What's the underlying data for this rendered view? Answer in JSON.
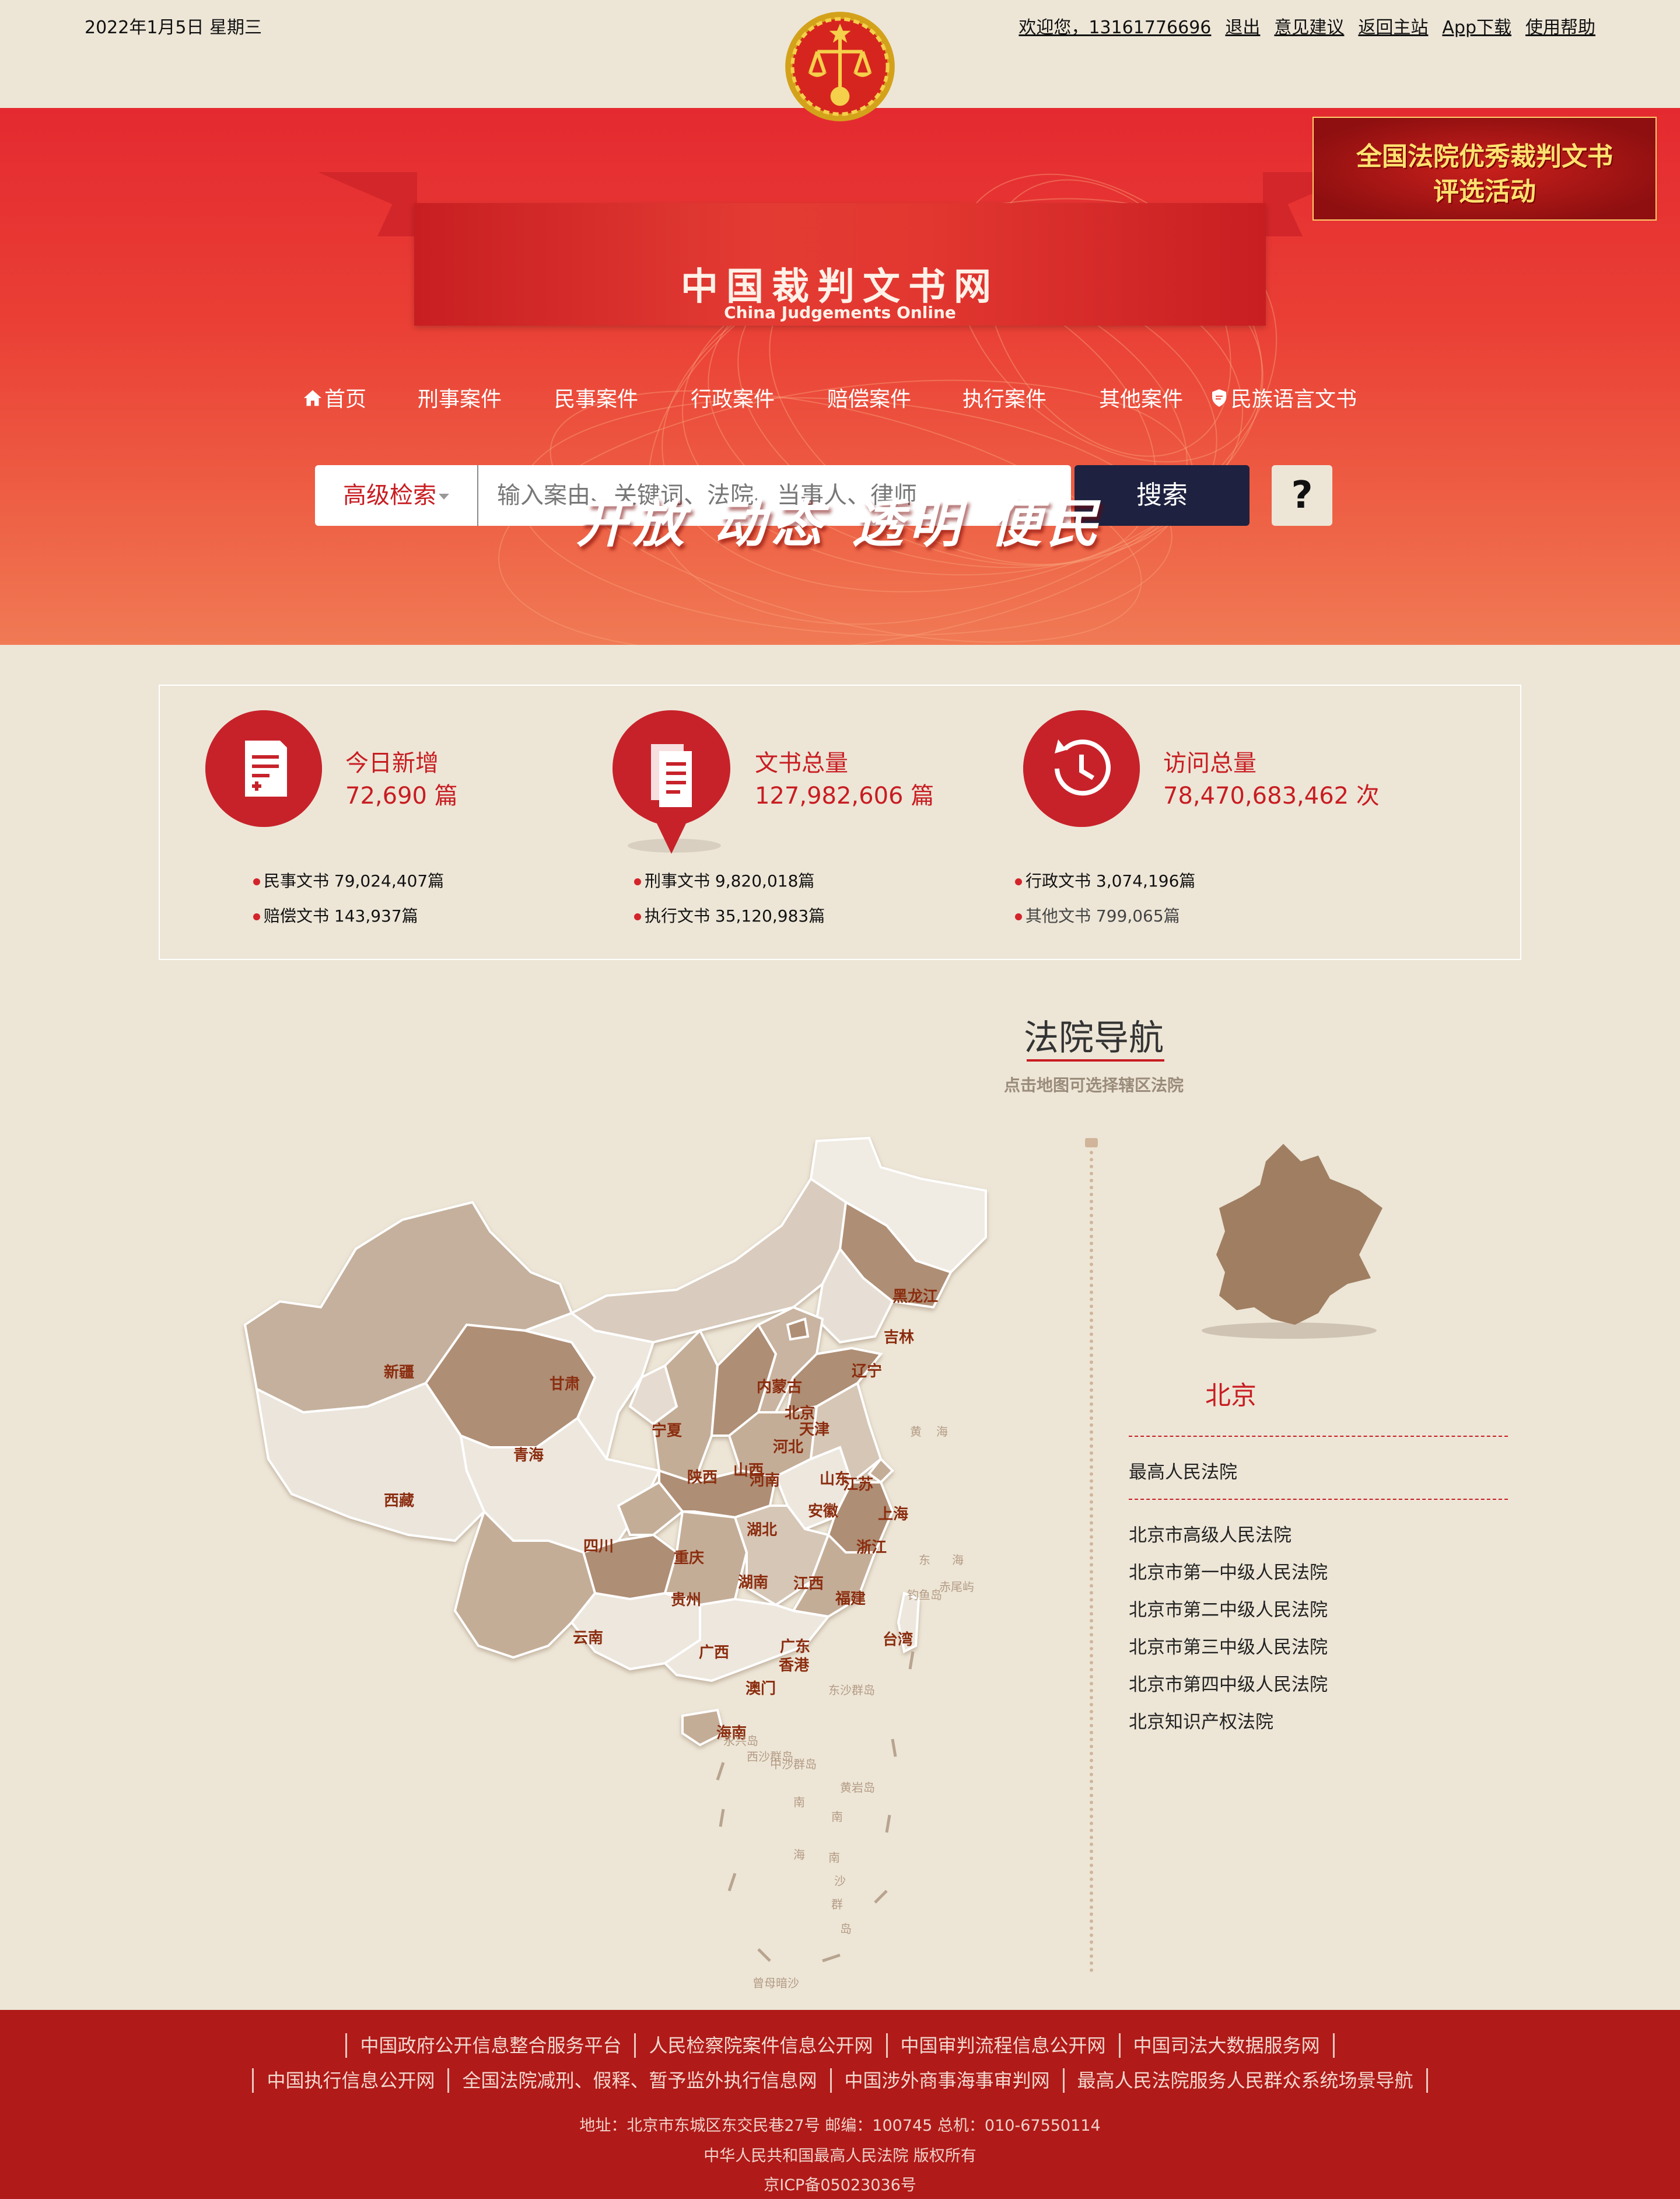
{
  "topbar": {
    "date": "2022年1月5日  星期三",
    "links": [
      "欢迎您，13161776696",
      "退出",
      "意见建议",
      "返回主站",
      "App下载",
      "使用帮助"
    ]
  },
  "header": {
    "title": "中国裁判文书网",
    "subtitle": "China Judgements Online",
    "promo_line1": "全国法院优秀裁判文书",
    "promo_line2": "评选活动"
  },
  "nav": {
    "items": [
      "首页",
      "刑事案件",
      "民事案件",
      "行政案件",
      "赔偿案件",
      "执行案件",
      "其他案件",
      "民族语言文书"
    ]
  },
  "search": {
    "advanced_label": "高级检索",
    "placeholder": "输入案由、关键词、法院、当事人、律师",
    "button_label": "搜索",
    "help_label": "?"
  },
  "slogan": "开放  动态  透明  便民",
  "stats": {
    "today": {
      "title": "今日新增",
      "value": "72,690 篇"
    },
    "total": {
      "title": "文书总量",
      "value": "127,982,606 篇"
    },
    "visits": {
      "title": "访问总量",
      "value": "78,470,683,462 次"
    },
    "breakdown": [
      "民事文书 79,024,407篇",
      "赔偿文书 143,937篇",
      "刑事文书 9,820,018篇",
      "执行文书 35,120,983篇",
      "行政文书 3,074,196篇",
      "其他文书 799,065篇"
    ]
  },
  "court_nav": {
    "title": "法院导航",
    "subtitle": "点击地图可选择辖区法院",
    "provinces": [
      "黑龙江",
      "吉林",
      "辽宁",
      "内蒙古",
      "北京",
      "天津",
      "河北",
      "山西",
      "山东",
      "新疆",
      "甘肃",
      "宁夏",
      "青海",
      "陕西",
      "河南",
      "江苏",
      "上海",
      "西藏",
      "四川",
      "重庆",
      "湖北",
      "安徽",
      "浙江",
      "贵州",
      "湖南",
      "江西",
      "福建",
      "云南",
      "广西",
      "广东",
      "香港",
      "台湾",
      "澳门",
      "海南"
    ],
    "seas": [
      "黄",
      "海",
      "东",
      "海",
      "钓鱼岛",
      "赤尾屿",
      "东沙群岛",
      "西沙群岛",
      "永兴岛",
      "中沙群岛",
      "南",
      "南",
      "海",
      "黄岩岛",
      "南",
      "沙",
      "群",
      "岛",
      "曾母暗沙"
    ],
    "selected_region": "北京",
    "supreme_court": "最高人民法院",
    "courts": [
      "北京市高级人民法院",
      "北京市第一中级人民法院",
      "北京市第二中级人民法院",
      "北京市第三中级人民法院",
      "北京市第四中级人民法院",
      "北京知识产权法院"
    ]
  },
  "footer": {
    "links_row1": [
      "中国政府公开信息整合服务平台",
      "人民检察院案件信息公开网",
      "中国审判流程信息公开网",
      "中国司法大数据服务网"
    ],
    "links_row2": [
      "中国执行信息公开网",
      "全国法院减刑、假释、暂予监外执行信息网",
      "中国涉外商事海事审判网",
      "最高人民法院服务人民群众系统场景导航"
    ],
    "address": "地址：北京市东城区东交民巷27号    邮编：100745    总机：010-67550114",
    "copyright": "中华人民共和国最高人民法院 版权所有",
    "icp": "京ICP备05023036号"
  },
  "colors": {
    "brand_red": "#c81d22",
    "search_button": "#1e2240",
    "footer_red": "#b01a18",
    "page_bg": "#ede6d7"
  }
}
